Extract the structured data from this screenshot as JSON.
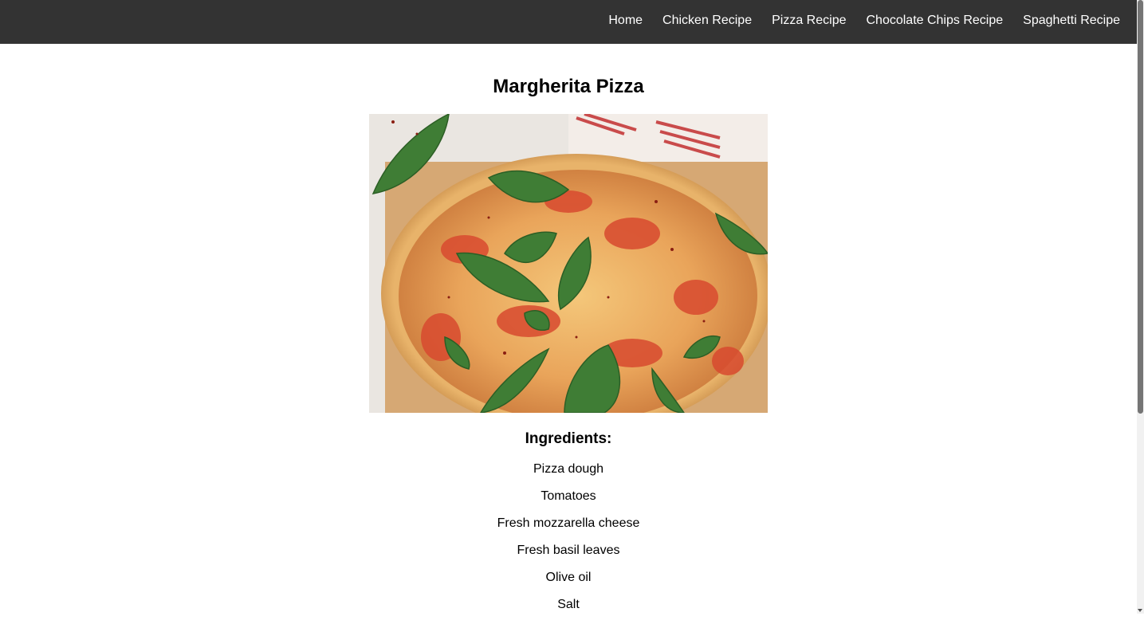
{
  "nav": {
    "links": [
      {
        "label": "Home"
      },
      {
        "label": "Chicken Recipe"
      },
      {
        "label": "Pizza Recipe"
      },
      {
        "label": "Chocolate Chips Recipe"
      },
      {
        "label": "Spaghetti Recipe"
      }
    ],
    "background": "#333333",
    "text_color": "#ffffff"
  },
  "recipe": {
    "title": "Margherita Pizza",
    "image_icon": "pizza-photo",
    "ingredients_heading": "Ingredients:",
    "ingredients": [
      "Pizza dough",
      "Tomatoes",
      "Fresh mozzarella cheese",
      "Fresh basil leaves",
      "Olive oil",
      "Salt"
    ]
  }
}
